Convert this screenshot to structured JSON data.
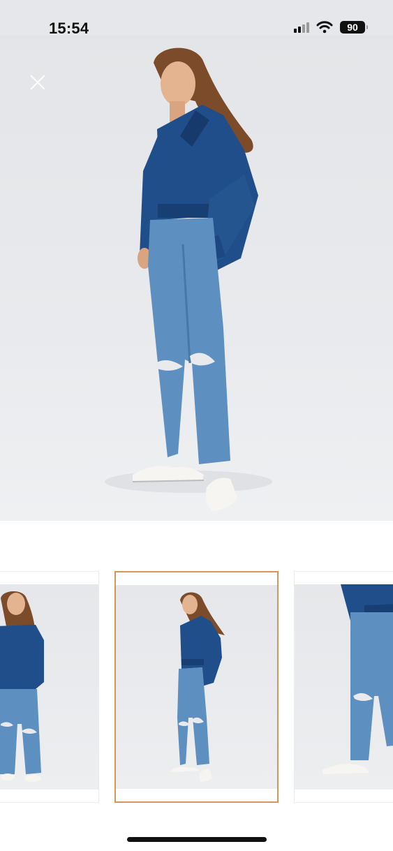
{
  "status_bar": {
    "time": "15:54",
    "battery": "90",
    "icons": [
      "cellular-signal-icon",
      "wifi-icon",
      "battery-icon"
    ]
  },
  "viewer": {
    "close_icon": "close-icon",
    "selected_index": 1,
    "thumbnail_count": 3,
    "accent_color": "#d59659"
  }
}
